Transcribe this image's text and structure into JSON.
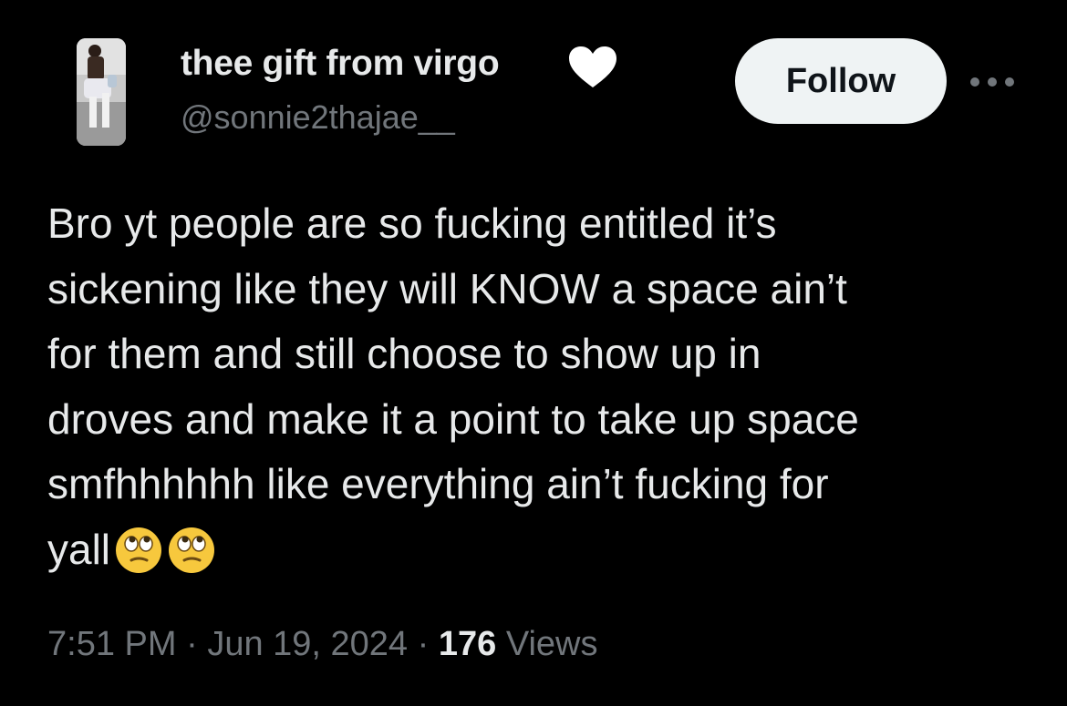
{
  "user": {
    "display_name": "thee gift from virgo",
    "name_icon": "white-heart-icon",
    "handle": "@sonnie2thajae__"
  },
  "actions": {
    "follow_label": "Follow",
    "more_icon": "more-options-icon"
  },
  "tweet": {
    "lines": [
      "Bro yt people are so fucking entitled it’s",
      "sickening like they will KNOW a space ain’t",
      "for them and still choose to show up in",
      "droves and make it a point to take up space",
      "smfhhhhhh like everything ain’t fucking for",
      "yall"
    ],
    "emoji": [
      "eye-roll-emoji",
      "eye-roll-emoji"
    ]
  },
  "meta": {
    "time": "7:51 PM",
    "separator": "·",
    "date": "Jun 19, 2024",
    "views_count": "176",
    "views_label": "Views"
  },
  "colors": {
    "background": "#000000",
    "primary_text": "#e7e9ea",
    "secondary_text": "#71767b",
    "follow_button_bg": "#eff3f4",
    "follow_button_text": "#0f1419",
    "emoji_yellow": "#f7c83d"
  }
}
